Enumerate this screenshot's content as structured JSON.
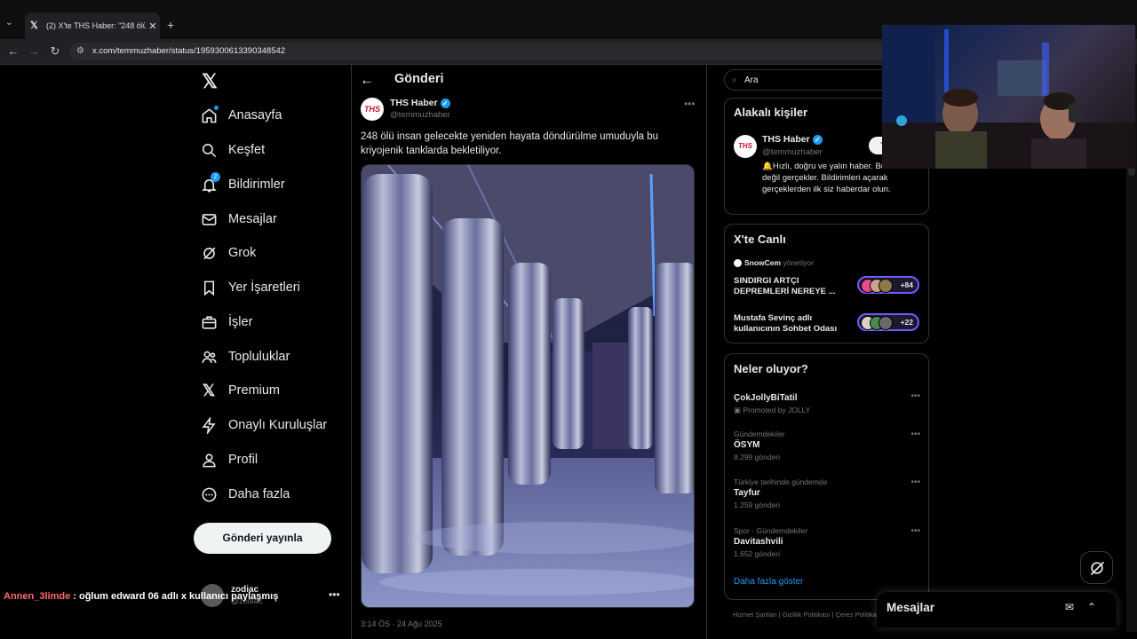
{
  "browser": {
    "tab_title": "(2) X'te THS Haber: \"248 ölü insan",
    "url": "x.com/temmuzhaber/status/1959300613390348542"
  },
  "nav": {
    "items": [
      {
        "label": "Anasayfa",
        "icon": "home-icon"
      },
      {
        "label": "Keşfet",
        "icon": "search-icon"
      },
      {
        "label": "Bildirimler",
        "icon": "bell-icon",
        "badge": "2"
      },
      {
        "label": "Mesajlar",
        "icon": "mail-icon"
      },
      {
        "label": "Grok",
        "icon": "grok-icon"
      },
      {
        "label": "Yer İşaretleri",
        "icon": "bookmark-icon"
      },
      {
        "label": "İşler",
        "icon": "briefcase-icon"
      },
      {
        "label": "Topluluklar",
        "icon": "people-icon"
      },
      {
        "label": "Premium",
        "icon": "x-logo-icon"
      },
      {
        "label": "Onaylı Kuruluşlar",
        "icon": "lightning-icon"
      },
      {
        "label": "Profil",
        "icon": "person-icon"
      },
      {
        "label": "Daha fazla",
        "icon": "more-circle-icon"
      }
    ],
    "post_button": "Gönderi yayınla",
    "user": {
      "name": "zodiac",
      "handle": "@zodiac"
    }
  },
  "chat_overlay": {
    "user": "Annen_3limde",
    "text": ": oğlum edward 06 adlı x kullanıcı paylaşmış"
  },
  "post": {
    "page_title": "Gönderi",
    "author_name": "THS Haber",
    "author_handle": "@temmuzhaber",
    "avatar_text": "THS",
    "text": "248 ölü insan gelecekte yeniden hayata döndürülme umuduyla bu kriyojenik tanklarda bekletiliyor.",
    "meta": "3:14 ÖS · 24 Ağu 2025"
  },
  "sidebar": {
    "search_placeholder": "Ara",
    "relevant": {
      "title": "Alakalı kişiler",
      "name": "THS Haber",
      "handle": "@temmuzhaber",
      "bio": "🔔Hızlı, doğru ve yalın haber. Beklentiler değil gerçekler. Bildirimleri açarak gerçeklerden ilk siz haberdar olun.",
      "follow": "Takip et"
    },
    "live": {
      "title": "X'te Canlı",
      "host": "SnowCem",
      "host_suffix": "yönetiyor",
      "spaces": [
        {
          "title": "SINDIRGI ARTÇI DEPREMLERİ NEREYE ...",
          "count": "+84"
        },
        {
          "title": "Mustafa Sevinç adlı kullanıcının Sohbet Odası",
          "count": "+22"
        }
      ]
    },
    "trends": {
      "title": "Neler oluyor?",
      "items": [
        {
          "category": "",
          "name": "ÇokJollyBiTatil",
          "count": "Promoted by JOLLY"
        },
        {
          "category": "Gündemdekiler",
          "name": "ÖSYM",
          "count": "8.299 gönderi"
        },
        {
          "category": "Türkiye tarihinde gündemde",
          "name": "Tayfur",
          "count": "1.259 gönderi"
        },
        {
          "category": "Spor · Gündemdekiler",
          "name": "Davitashvili",
          "count": "1.652 gönderi"
        }
      ],
      "show_more": "Daha fazla göster"
    },
    "footer": "Hizmet Şartları  |  Gizlilik Politikası  |  Çerez Politikası"
  },
  "messages_drawer": {
    "title": "Mesajlar"
  }
}
